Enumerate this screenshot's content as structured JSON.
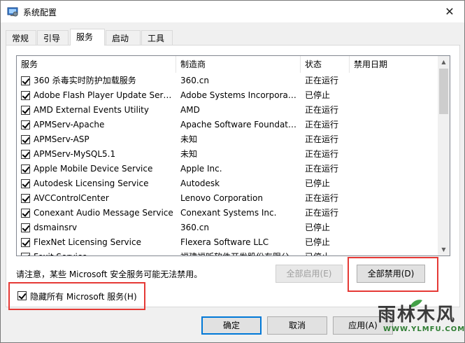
{
  "window": {
    "title": "系统配置",
    "close_glyph": "✕"
  },
  "tabs": [
    "常规",
    "引导",
    "服务",
    "启动",
    "工具"
  ],
  "active_tab": "服务",
  "columns": [
    "服务",
    "制造商",
    "状态",
    "禁用日期"
  ],
  "services": [
    {
      "name": "360 杀毒实时防护加载服务",
      "vendor": "360.cn",
      "status": "正在运行",
      "checked": true
    },
    {
      "name": "Adobe Flash Player Update Servi...",
      "vendor": "Adobe Systems Incorporat...",
      "status": "已停止",
      "checked": true
    },
    {
      "name": "AMD External Events Utility",
      "vendor": "AMD",
      "status": "正在运行",
      "checked": true
    },
    {
      "name": "APMServ-Apache",
      "vendor": "Apache Software Foundati...",
      "status": "正在运行",
      "checked": true
    },
    {
      "name": "APMServ-ASP",
      "vendor": "未知",
      "status": "正在运行",
      "checked": true
    },
    {
      "name": "APMServ-MySQL5.1",
      "vendor": "未知",
      "status": "正在运行",
      "checked": true
    },
    {
      "name": "Apple Mobile Device Service",
      "vendor": "Apple Inc.",
      "status": "正在运行",
      "checked": true
    },
    {
      "name": "Autodesk Licensing Service",
      "vendor": "Autodesk",
      "status": "已停止",
      "checked": true
    },
    {
      "name": "AVCControlCenter",
      "vendor": "Lenovo Corporation",
      "status": "正在运行",
      "checked": true
    },
    {
      "name": "Conexant Audio Message Service",
      "vendor": "Conexant Systems Inc.",
      "status": "正在运行",
      "checked": true
    },
    {
      "name": "dsmainsrv",
      "vendor": "360.cn",
      "status": "已停止",
      "checked": true
    },
    {
      "name": "FlexNet Licensing Service",
      "vendor": "Flexera Software LLC",
      "status": "已停止",
      "checked": true
    },
    {
      "name": "Foxit Service",
      "vendor": "福建福昕软件开发股份有限公",
      "status": "已停止",
      "checked": true
    }
  ],
  "notice": "请注意，某些 Microsoft 安全服务可能无法禁用。",
  "buttons": {
    "enable_all": "全部启用(E)",
    "disable_all": "全部禁用(D)",
    "ok": "确定",
    "cancel": "取消",
    "apply": "应用(A)"
  },
  "hide_ms": {
    "label": "隐藏所有 Microsoft 服务(H)",
    "checked": true
  },
  "watermark": {
    "text": "雨林木风",
    "url": "WWW.YLMFU.COM"
  },
  "colors": {
    "highlight_box": "#e53935",
    "default_button_border": "#0078d7"
  }
}
